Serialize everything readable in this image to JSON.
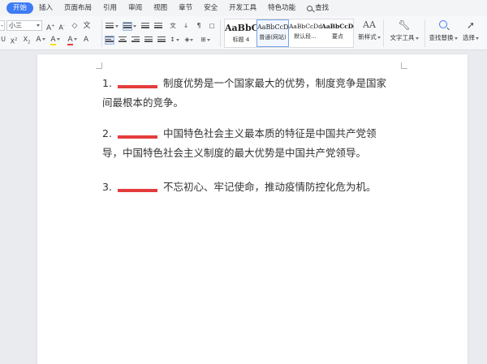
{
  "tabs": [
    {
      "label": "开始",
      "active": true
    },
    {
      "label": "插入"
    },
    {
      "label": "页面布局"
    },
    {
      "label": "引用"
    },
    {
      "label": "审阅"
    },
    {
      "label": "视图"
    },
    {
      "label": "章节"
    },
    {
      "label": "安全"
    },
    {
      "label": "开发工具"
    },
    {
      "label": "特色功能"
    }
  ],
  "search_tab": {
    "label": "查找"
  },
  "ribbon": {
    "font_name": "-",
    "font_size": "小三",
    "grow_font": "A",
    "shrink_font": "A",
    "clear_format": "◇",
    "pinyin": "文",
    "superscript": "X",
    "subscript": "X",
    "highlight": "A",
    "font_color": "A",
    "char_border": "A",
    "styles": [
      {
        "preview": "AaBbC",
        "name": "标题 4",
        "selected": false
      },
      {
        "preview": "AaBbCcD",
        "name": "普通(网站)",
        "selected": true
      },
      {
        "preview": "AaBbCcDd",
        "name": "默认段...",
        "selected": false
      },
      {
        "preview": "AaBbCcDc",
        "name": "要点",
        "selected": false
      }
    ],
    "new_style_label": "新样式",
    "text_tools_label": "文字工具",
    "find_replace_label": "查找替换",
    "select_label": "选择"
  },
  "document": {
    "paragraphs": [
      {
        "number": "1.",
        "lines": [
          "制度优势是一个国家最大的优势，制度竞争是国家",
          "间最根本的竞争。"
        ]
      },
      {
        "number": "2.",
        "lines": [
          "中国特色社会主义最本质的特征是中国共产党领",
          "导，中国特色社会主义制度的最大优势是中国共产党领导。"
        ]
      },
      {
        "number": "3.",
        "lines": [
          "不忘初心、牢记使命，推动疫情防控化危为机。"
        ]
      }
    ]
  },
  "colors": {
    "accent": "#3e7bf5",
    "blank_underline": "#e43c3c"
  }
}
